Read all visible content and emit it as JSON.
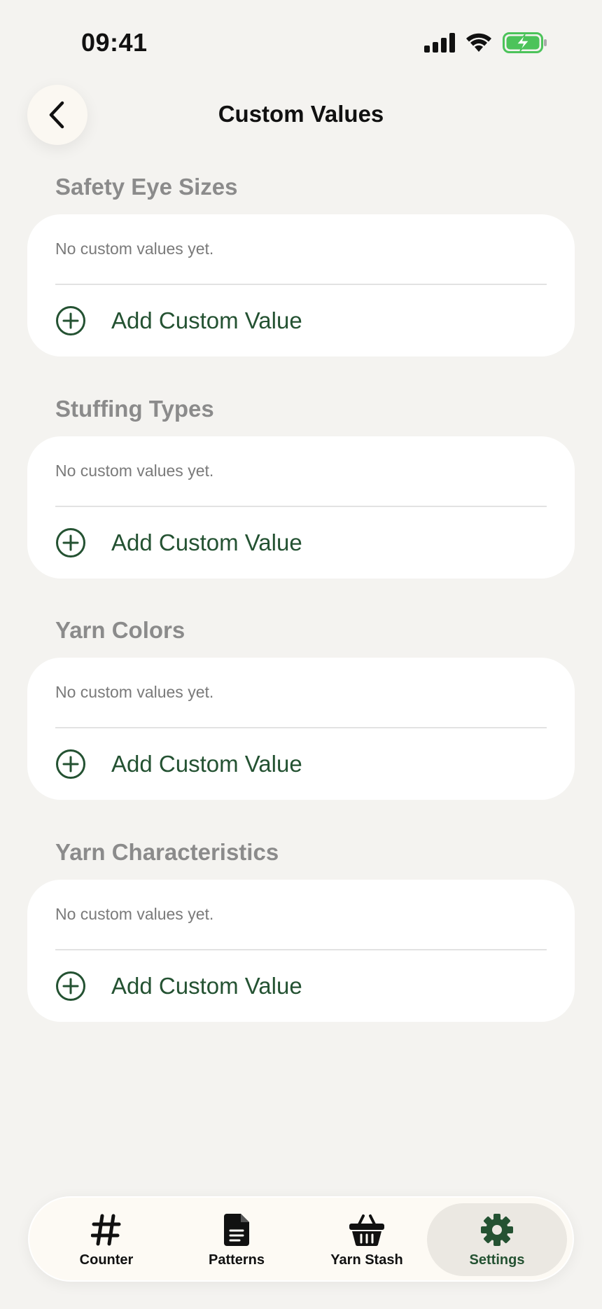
{
  "status_bar": {
    "time": "09:41"
  },
  "header": {
    "title": "Custom Values"
  },
  "sections": [
    {
      "title": "Safety Eye Sizes",
      "empty_text": "No custom values yet.",
      "add_label": "Add Custom Value"
    },
    {
      "title": "Stuffing Types",
      "empty_text": "No custom values yet.",
      "add_label": "Add Custom Value"
    },
    {
      "title": "Yarn Colors",
      "empty_text": "No custom values yet.",
      "add_label": "Add Custom Value"
    },
    {
      "title": "Yarn Characteristics",
      "empty_text": "No custom values yet.",
      "add_label": "Add Custom Value"
    }
  ],
  "tab_bar": {
    "tabs": [
      {
        "label": "Counter",
        "icon": "hashtag-icon"
      },
      {
        "label": "Patterns",
        "icon": "document-icon"
      },
      {
        "label": "Yarn Stash",
        "icon": "basket-icon"
      },
      {
        "label": "Settings",
        "icon": "gear-icon",
        "active": true
      }
    ]
  },
  "colors": {
    "background": "#f4f3f0",
    "accent_green": "#245232",
    "section_header_gray": "#8b8b8b",
    "battery_green": "#4cc35a"
  }
}
